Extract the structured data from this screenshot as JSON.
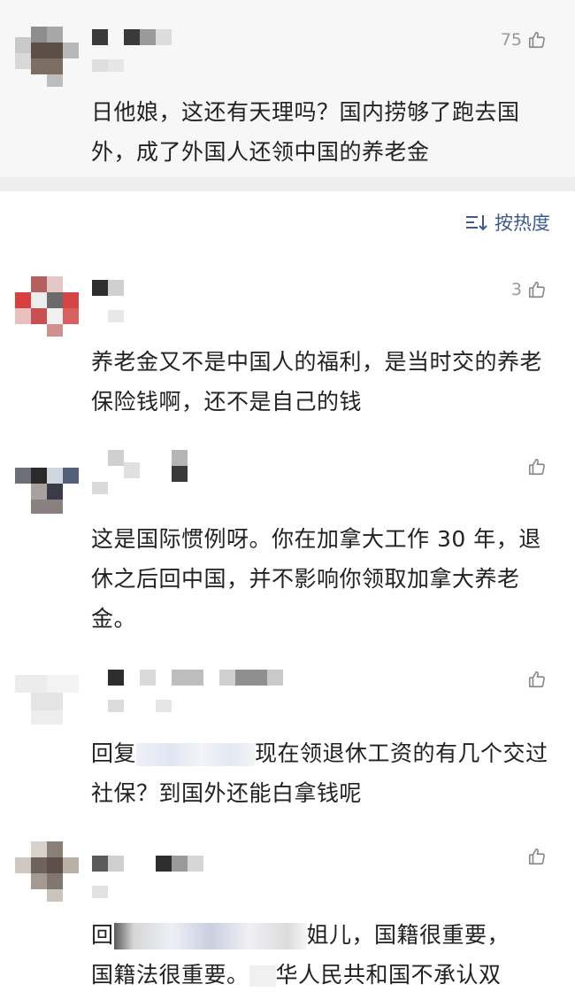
{
  "top_comment": {
    "likes": "75",
    "text": "日他娘，这还有天理吗？国内捞够了跑去国外，成了外国人还领中国的养老金"
  },
  "sort": {
    "label": "按热度",
    "icon": "sort-icon"
  },
  "comments": [
    {
      "likes": "3",
      "text": "养老金又不是中国人的福利，是当时交的养老保险钱啊，还不是自己的钱"
    },
    {
      "likes": "",
      "text": "这是国际惯例呀。你在加拿大工作 30 年，退休之后回中国，并不影响你领取加拿大养老金。"
    },
    {
      "likes": "",
      "text_prefix": "回复",
      "text": "现在领退休工资的有几个交过社保？到国外还能白拿钱呢"
    },
    {
      "likes": "",
      "text_prefix": "回",
      "text_line1": "姐儿，国籍很重要，",
      "text_line2a": "国籍法很重要。",
      "text_line2b": "华人民共和国不承认双"
    }
  ],
  "icons": {
    "like": "thumbs-up-icon"
  }
}
